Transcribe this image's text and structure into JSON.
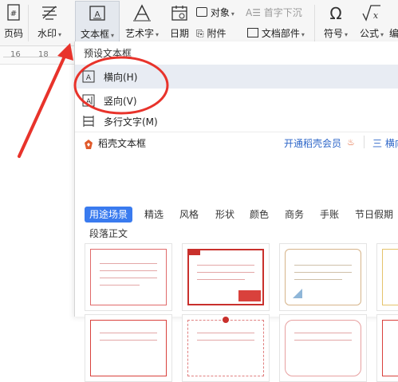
{
  "ribbon": {
    "page_num_label": "页码",
    "watermark_label": "水印",
    "textbox_label": "文本框",
    "wordart_label": "艺术字",
    "date_label": "日期",
    "object_label": "对象",
    "attachment_label": "附件",
    "dropcap_label": "首字下沉",
    "docparts_label": "文档部件",
    "symbol_label": "符号",
    "formula_label": "公式",
    "edge_label": "编"
  },
  "ruler": {
    "ticks": [
      "16",
      "18"
    ]
  },
  "dropdown": {
    "preset_title": "预设文本框",
    "horizontal_label": "横向(H)",
    "vertical_label": "竖向(V)",
    "multiline_label": "多行文字(M)",
    "daoke_title": "稻壳文本框",
    "vip_link": "开通稻壳会员",
    "side_label": "三 横向",
    "categories": [
      "用途场景",
      "精选",
      "风格",
      "形状",
      "颜色",
      "商务",
      "手账",
      "节日假期"
    ],
    "subcategory": "段落正文"
  },
  "colors": {
    "accent": "#3a7bef",
    "annotation": "#e8332b",
    "brand_red": "#e05a2b"
  }
}
